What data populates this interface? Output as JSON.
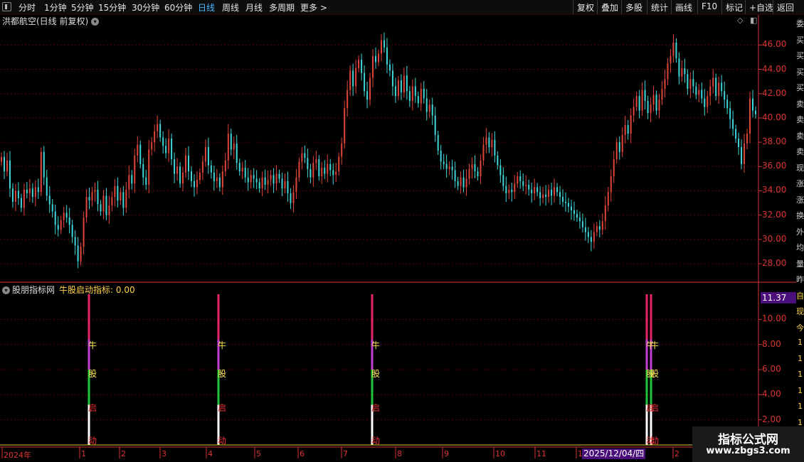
{
  "toolbar": {
    "periods": [
      "分时",
      "1分钟",
      "5分钟",
      "15分钟",
      "30分钟",
      "60分钟",
      "日线",
      "周线",
      "月线",
      "多周期",
      "更多 >"
    ],
    "active_period": "日线",
    "right_buttons": [
      "复权",
      "叠加",
      "多股",
      "统计",
      "画线",
      "F10",
      "标记",
      "+自选",
      "返回"
    ]
  },
  "main_chart": {
    "title": "洪都航空(日线 前复权)",
    "y_labels": [
      "46.00",
      "44.00",
      "42.00",
      "40.00",
      "38.00",
      "36.00",
      "34.00",
      "32.00",
      "30.00",
      "28.00"
    ]
  },
  "indicator": {
    "source_name": "股朋指标网",
    "indicator_text": "牛股启动指标: 0.00",
    "current_value": "11.37",
    "y_labels": [
      "10.00",
      "8.00",
      "6.00",
      "4.00",
      "2.00"
    ],
    "signal_chars": [
      "牛",
      "股",
      "启",
      "动"
    ]
  },
  "x_axis": {
    "labels": [
      "2024年",
      "1",
      "2",
      "3",
      "4",
      "5",
      "6",
      "7",
      "8",
      "9",
      "10",
      "11",
      "1",
      "2"
    ],
    "cursor_date": "2025/12/04/四"
  },
  "side_chars": [
    "委",
    "买",
    "买",
    "买",
    "买",
    "卖",
    "卖",
    "卖",
    "卖",
    "现",
    "涨",
    "涨",
    "换",
    "外",
    "均",
    "量",
    "昨",
    "自",
    "现",
    "今",
    "1",
    "1",
    "1",
    "1",
    "1",
    "1",
    "1"
  ],
  "watermark": {
    "line1": "指标公式网",
    "line2": "www.zbgs3.com"
  },
  "colors": {
    "up": "#e0453a",
    "down": "#3fd7d9",
    "grid": "#5a0000",
    "axis": "#d33333",
    "bar_top": "#e8256a",
    "bar_mid": "#c03fd0",
    "bar_green": "#22c43a",
    "bar_white": "#ffffff"
  },
  "chart_data": {
    "type": "candlestick",
    "ylim": [
      26.6,
      47.6
    ],
    "close": [
      36.8,
      35.6,
      36.5,
      34.2,
      33.1,
      34.0,
      33.4,
      32.6,
      34.1,
      33.8,
      34.2,
      33.5,
      34.3,
      33.9,
      37.2,
      35.1,
      33.6,
      32.9,
      32.3,
      31.2,
      30.8,
      31.6,
      32.2,
      31.8,
      31.2,
      30.2,
      29.5,
      28.2,
      29.4,
      31.8,
      33.5,
      33.2,
      33.9,
      34.1,
      32.9,
      32.3,
      33.6,
      32.0,
      32.8,
      33.5,
      34.4,
      33.2,
      33.9,
      32.6,
      34.1,
      35.3,
      34.6,
      36.9,
      37.8,
      36.2,
      35.1,
      34.5,
      37.4,
      38.0,
      38.9,
      39.5,
      38.4,
      37.7,
      37.1,
      38.3,
      36.6,
      35.4,
      36.0,
      34.6,
      35.5,
      36.9,
      35.6,
      34.8,
      34.3,
      34.9,
      35.5,
      36.4,
      37.6,
      36.1,
      35.5,
      34.8,
      35.1,
      34.3,
      35.6,
      36.5,
      38.7,
      37.4,
      37.9,
      36.3,
      35.6,
      35.9,
      35.1,
      34.7,
      35.3,
      35.0,
      34.7,
      34.2,
      35.1,
      34.5,
      34.9,
      35.3,
      34.6,
      35.4,
      35.0,
      34.2,
      34.8,
      33.8,
      33.0,
      33.9,
      35.1,
      36.4,
      37.1,
      36.7,
      35.8,
      35.1,
      36.3,
      36.6,
      35.2,
      35.9,
      35.4,
      36.2,
      35.7,
      35.3,
      35.6,
      36.8,
      37.9,
      40.8,
      42.3,
      43.9,
      42.6,
      44.1,
      44.8,
      43.7,
      42.2,
      41.5,
      43.3,
      45.1,
      44.6,
      45.3,
      46.4,
      45.8,
      44.4,
      43.9,
      42.6,
      41.8,
      43.1,
      42.1,
      43.5,
      42.2,
      41.4,
      42.6,
      41.8,
      41.2,
      42.4,
      41.6,
      40.5,
      41.1,
      40.2,
      38.6,
      37.3,
      36.4,
      36.2,
      35.8,
      36.0,
      35.7,
      34.8,
      34.4,
      35.1,
      34.3,
      35.0,
      35.8,
      36.2,
      35.6,
      35.2,
      36.5,
      37.8,
      38.4,
      37.6,
      38.2,
      36.9,
      36.1,
      35.3,
      34.4,
      33.8,
      34.1,
      33.9,
      34.6,
      35.2,
      34.8,
      34.4,
      34.5,
      34.1,
      33.8,
      34.3,
      33.9,
      33.4,
      33.7,
      33.5,
      34.1,
      33.6,
      34.3,
      33.9,
      33.5,
      33.1,
      33.0,
      32.7,
      32.4,
      32.1,
      31.8,
      31.5,
      31.0,
      30.6,
      30.2,
      29.8,
      30.6,
      31.1,
      30.8,
      31.5,
      32.8,
      33.9,
      35.2,
      36.6,
      38.0,
      37.2,
      38.6,
      39.4,
      38.7,
      40.2,
      40.9,
      41.8,
      40.6,
      42.3,
      41.4,
      40.4,
      41.1,
      41.9,
      40.6,
      41.5,
      42.4,
      43.2,
      44.5,
      45.1,
      46.2,
      44.9,
      43.4,
      44.1,
      43.6,
      42.4,
      43.2,
      42.6,
      41.9,
      42.3,
      41.6,
      40.9,
      41.8,
      42.6,
      43.3,
      41.8,
      42.9,
      42.2,
      41.5,
      40.8,
      39.9,
      39.1,
      38.3,
      37.6,
      36.2,
      37.9,
      38.7,
      41.6,
      40.6,
      40.3
    ]
  }
}
